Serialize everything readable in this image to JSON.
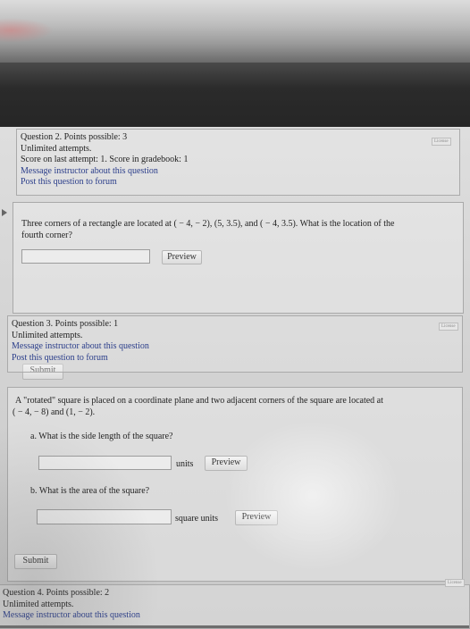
{
  "license_label": "License",
  "question2": {
    "header": "Question 2. Points possible: 3",
    "attempts": "Unlimited attempts.",
    "score": "Score on last attempt: 1. Score in gradebook: 1",
    "message_link": "Message instructor about this question",
    "forum_link": "Post this question to forum",
    "prompt_line1": "Three corners of a rectangle are located at ( − 4,  − 2), (5, 3.5), and ( − 4, 3.5). What is the location of the",
    "prompt_line2": "fourth corner?",
    "preview_label": "Preview",
    "submit_label": "Submit"
  },
  "question3": {
    "header": "Question 3. Points possible: 1",
    "attempts": "Unlimited attempts.",
    "message_link": "Message instructor about this question",
    "forum_link": "Post this question to forum",
    "prompt_line1": "A \"rotated\" square is placed on a coordinate plane and two adjacent corners of the square are located at",
    "prompt_line2": "( − 4,  − 8) and (1,  − 2).",
    "part_a": "a. What is the side length of the square?",
    "part_a_unit": "units",
    "part_b": "b. What is the area of the square?",
    "part_b_unit": "square units",
    "preview_label": "Preview",
    "submit_label": "Submit"
  },
  "question4": {
    "header": "Question 4. Points possible: 2",
    "attempts": "Unlimited attempts.",
    "message_link": "Message instructor about this question"
  }
}
